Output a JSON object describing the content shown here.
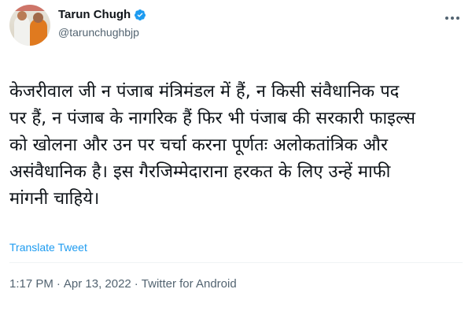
{
  "author": {
    "name": "Tarun Chugh",
    "handle": "@tarunchughbjp",
    "verified": true
  },
  "tweet": {
    "lines": [
      "केजरीवाल जी न पंजाब मंत्रिमंडल में हैं, न किसी संवैधानिक पद",
      "पर हैं, न पंजाब के नागरिक हैं फिर भी पंजाब की सरकारी फाइल्स",
      "को खोलना और उन पर चर्चा करना पूर्णतः अलोकतांत्रिक और",
      "असंवैधानिक है। इस गैरजिम्मेदाराना हरकत के लिए उन्हें माफी",
      "मांगनी चाहिये।"
    ],
    "translate_label": "Translate Tweet"
  },
  "meta": {
    "time": "1:17 PM",
    "separator": "·",
    "date": "Apr 13, 2022",
    "source": "Twitter for Android"
  },
  "colors": {
    "accent": "#1d9bf0",
    "secondary_text": "#536471",
    "primary_text": "#0f1419"
  },
  "icons": {
    "verified": "verified-badge-icon",
    "more": "more-options-icon"
  }
}
